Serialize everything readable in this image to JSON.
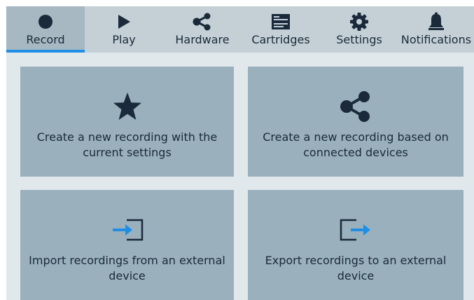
{
  "tabs": [
    {
      "label": "Record",
      "icon": "record-icon",
      "active": true
    },
    {
      "label": "Play",
      "icon": "play-icon",
      "active": false
    },
    {
      "label": "Hardware",
      "icon": "share-icon",
      "active": false
    },
    {
      "label": "Cartridges",
      "icon": "cartridges-icon",
      "active": false
    },
    {
      "label": "Settings",
      "icon": "gear-icon",
      "active": false
    },
    {
      "label": "Notifications",
      "icon": "bell-icon",
      "active": false
    }
  ],
  "cards": [
    {
      "label": "Create a new recording with the current settings",
      "icon": "star-icon"
    },
    {
      "label": "Create a new recording based on connected devices",
      "icon": "share-icon"
    },
    {
      "label": "Import recordings from an external device",
      "icon": "import-icon"
    },
    {
      "label": "Export recordings to an external device",
      "icon": "export-icon"
    }
  ],
  "colors": {
    "accent": "#1f8fe6",
    "icon_dark": "#1a2a3a",
    "card_bg": "#9ab0bc",
    "tabbar_bg": "#c4d0d6",
    "tab_active_bg": "#a7b8c2",
    "content_bg": "#e0e8eb"
  }
}
